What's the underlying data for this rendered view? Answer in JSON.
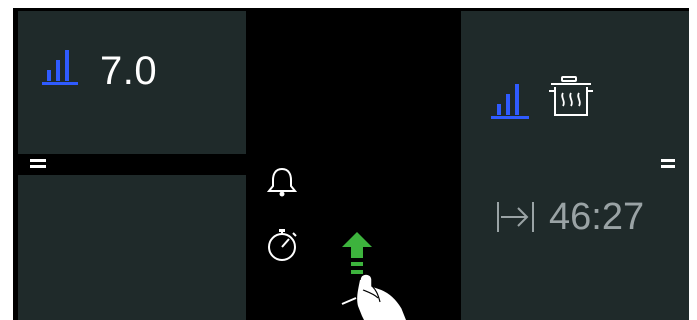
{
  "left_panel": {
    "power_level": "7.0"
  },
  "center": {
    "icons": [
      "bell-icon",
      "stopwatch-icon",
      "boost-arrow-icon",
      "touch-hand-icon"
    ]
  },
  "right_panel": {
    "cooking_time": "46:27",
    "icons": [
      "power-bars-icon",
      "pot-steam-icon",
      "timer-arrow-icon"
    ]
  },
  "colors": {
    "panel": "#1f2a2a",
    "accent_blue": "#2f5bff",
    "boost_green": "#3db33d",
    "timer_grey": "#9aa3a5"
  }
}
